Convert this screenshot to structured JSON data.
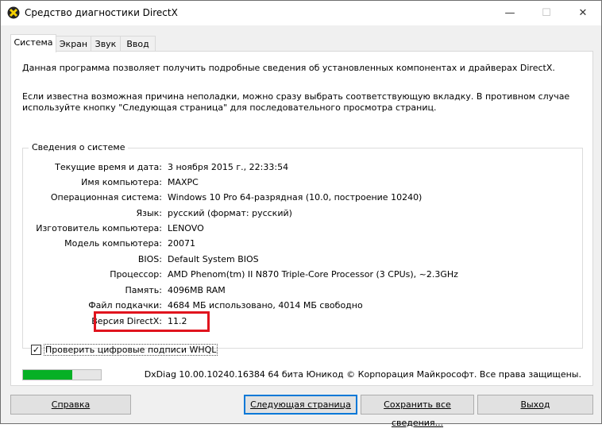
{
  "window": {
    "title": "Средство диагностики DirectX",
    "controls": {
      "minimize": "—",
      "maximize": "☐",
      "close": "✕"
    }
  },
  "tabs": [
    {
      "label": "Система"
    },
    {
      "label": "Экран"
    },
    {
      "label": "Звук"
    },
    {
      "label": "Ввод"
    }
  ],
  "intro": {
    "line1": "Данная программа позволяет получить подробные сведения об установленных компонентах и драйверах DirectX.",
    "line2": "Если известна возможная причина неполадки, можно сразу выбрать соответствующую вкладку. В противном случае используйте кнопку \"Следующая страница\" для последовательного просмотра страниц."
  },
  "system_info": {
    "group_title": "Сведения о системе",
    "rows": [
      {
        "label": "Текущие время и дата:",
        "value": "3 ноября 2015 г., 22:33:54"
      },
      {
        "label": "Имя компьютера:",
        "value": "MAXPC"
      },
      {
        "label": "Операционная система:",
        "value": "Windows 10 Pro 64-разрядная (10.0, построение 10240)"
      },
      {
        "label": "Язык:",
        "value": "русский (формат: русский)"
      },
      {
        "label": "Изготовитель компьютера:",
        "value": "LENOVO"
      },
      {
        "label": "Модель компьютера:",
        "value": "20071"
      },
      {
        "label": "BIOS:",
        "value": "Default System BIOS"
      },
      {
        "label": "Процессор:",
        "value": "AMD Phenom(tm) II N870 Triple-Core Processor (3 CPUs), ~2.3GHz"
      },
      {
        "label": "Память:",
        "value": "4096MB RAM"
      },
      {
        "label": "Файл подкачки:",
        "value": "4684 МБ использовано, 4014 МБ свободно"
      },
      {
        "label": "Версия DirectX:",
        "value": "11.2"
      }
    ]
  },
  "whql_checkbox": {
    "label": "Проверить цифровые подписи WHQL",
    "checked": true,
    "mark": "✓"
  },
  "progress": {
    "fraction": 0.63,
    "color": "#06b025"
  },
  "footer_text": "DxDiag 10.00.10240.16384 64 бита Юникод © Корпорация Майкрософт. Все права защищены.",
  "buttons": {
    "help": "Справка",
    "next": "Следующая страница",
    "save": "Сохранить все сведения...",
    "exit": "Выход"
  },
  "colors": {
    "highlight": "#e0141e",
    "accent": "#0078d7"
  }
}
